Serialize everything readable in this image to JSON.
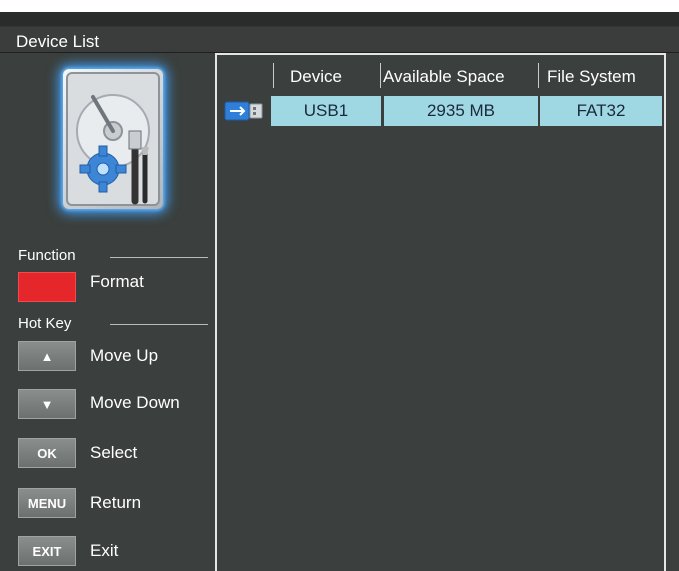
{
  "window": {
    "title": "Device List"
  },
  "table": {
    "columns": [
      "Device",
      "Available Space",
      "File System"
    ],
    "rows": [
      {
        "device": "USB1",
        "available_space": "2935 MB",
        "file_system": "FAT32",
        "icon": "usb-drive-icon"
      }
    ]
  },
  "function": {
    "heading": "Function",
    "items": [
      {
        "key_label": "",
        "label": "Format",
        "key_color": "#e5262b"
      }
    ]
  },
  "hotkeys": {
    "heading": "Hot Key",
    "items": [
      {
        "key_label": "▲",
        "label": "Move Up"
      },
      {
        "key_label": "▼",
        "label": "Move Down"
      },
      {
        "key_label": "OK",
        "label": "Select"
      },
      {
        "key_label": "MENU",
        "label": "Return"
      },
      {
        "key_label": "EXIT",
        "label": "Exit"
      }
    ]
  },
  "colors": {
    "accent": "#9fd7e3",
    "background": "#3b3f3d",
    "function_key": "#e5262b"
  }
}
